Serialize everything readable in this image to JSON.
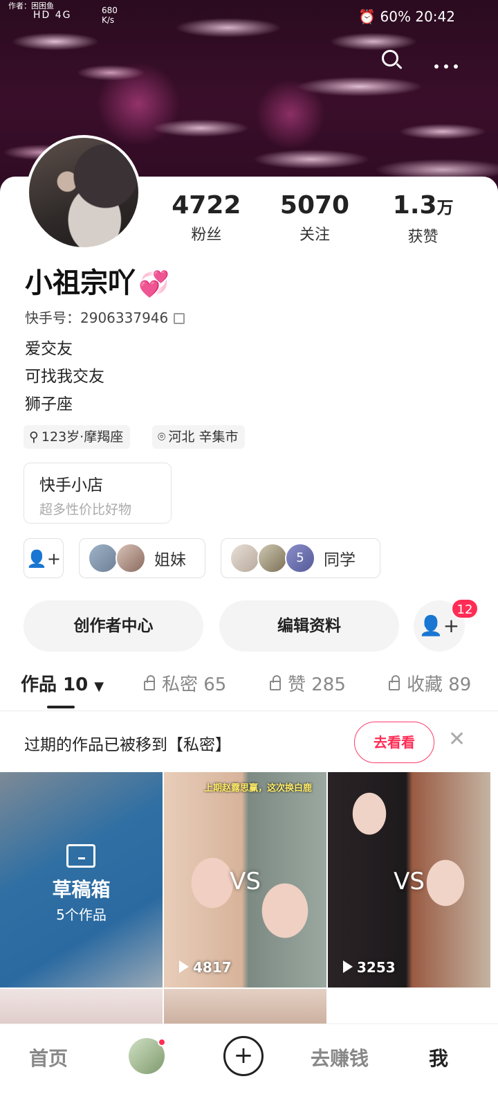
{
  "status_bar": {
    "author": "作者：困困鱼",
    "signal": "HD 4G",
    "speed": "680 K/s",
    "right": "⏰ 60%  20:42"
  },
  "header": {
    "icons": [
      "search-icon",
      "more-icon"
    ]
  },
  "profile": {
    "nickname": "小祖宗吖",
    "nickname_emoji": "💞",
    "kuaishou_id_label": "快手号：",
    "kuaishou_id": "2906337946",
    "bio": [
      "爱交友",
      "可找我交友",
      "狮子座"
    ],
    "tags": [
      {
        "icon": "gender-icon",
        "text": "123岁·摩羯座"
      },
      {
        "icon": "location-icon",
        "text": "河北 辛集市"
      }
    ],
    "stats": [
      {
        "value": "4722",
        "unit": "",
        "label": "粉丝"
      },
      {
        "value": "5070",
        "unit": "",
        "label": "关注"
      },
      {
        "value": "1.3",
        "unit": "万",
        "label": "获赞"
      }
    ]
  },
  "shop": {
    "title": "快手小店",
    "subtitle": "超多性价比好物"
  },
  "relations": [
    {
      "label": "姐妹",
      "count_badge": ""
    },
    {
      "label": "同学",
      "count_badge": "5"
    }
  ],
  "actions": {
    "creator_center": "创作者中心",
    "edit_profile": "编辑资料",
    "friend_badge": "12"
  },
  "tabs": [
    {
      "label": "作品 10",
      "active": true,
      "locked": false
    },
    {
      "label": "私密 65",
      "active": false,
      "locked": true
    },
    {
      "label": "赞 285",
      "active": false,
      "locked": true
    },
    {
      "label": "收藏 89",
      "active": false,
      "locked": true
    }
  ],
  "notice": {
    "text": "过期的作品已被移到【私密】",
    "button": "去看看"
  },
  "grid": {
    "draft_title": "草稿箱",
    "draft_count": "5个作品",
    "videos": [
      {
        "caption": "上期赵露思赢，这次换白鹿",
        "vs": "VS",
        "plays": "4817"
      },
      {
        "caption": "",
        "vs": "VS",
        "plays": "3253"
      }
    ]
  },
  "bottom_nav": {
    "home": "首页",
    "earn": "去赚钱",
    "me": "我"
  },
  "colors": {
    "accent": "#ff2d55",
    "banner": "#3a0e2a"
  }
}
